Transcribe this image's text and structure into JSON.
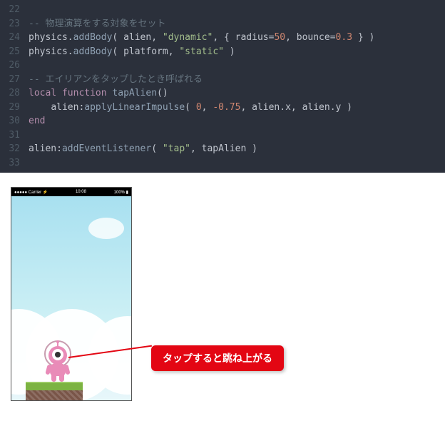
{
  "code": {
    "lines": [
      {
        "num": "22",
        "tokens": []
      },
      {
        "num": "23",
        "tokens": [
          {
            "t": "comment",
            "v": "-- 物理演算をする対象をセット"
          }
        ]
      },
      {
        "num": "24",
        "tokens": [
          {
            "t": "ident",
            "v": "physics"
          },
          {
            "t": "punct",
            "v": "."
          },
          {
            "t": "func",
            "v": "addBody"
          },
          {
            "t": "punct",
            "v": "( "
          },
          {
            "t": "ident",
            "v": "alien"
          },
          {
            "t": "punct",
            "v": ", "
          },
          {
            "t": "string",
            "v": "\"dynamic\""
          },
          {
            "t": "punct",
            "v": ", { "
          },
          {
            "t": "ident",
            "v": "radius"
          },
          {
            "t": "punct",
            "v": "="
          },
          {
            "t": "number",
            "v": "50"
          },
          {
            "t": "punct",
            "v": ", "
          },
          {
            "t": "ident",
            "v": "bounce"
          },
          {
            "t": "punct",
            "v": "="
          },
          {
            "t": "number",
            "v": "0.3"
          },
          {
            "t": "punct",
            "v": " } )"
          }
        ]
      },
      {
        "num": "25",
        "tokens": [
          {
            "t": "ident",
            "v": "physics"
          },
          {
            "t": "punct",
            "v": "."
          },
          {
            "t": "func",
            "v": "addBody"
          },
          {
            "t": "punct",
            "v": "( "
          },
          {
            "t": "ident",
            "v": "platform"
          },
          {
            "t": "punct",
            "v": ", "
          },
          {
            "t": "string",
            "v": "\"static\""
          },
          {
            "t": "punct",
            "v": " )"
          }
        ]
      },
      {
        "num": "26",
        "tokens": []
      },
      {
        "num": "27",
        "tokens": [
          {
            "t": "comment",
            "v": "-- エイリアンをタップしたとき呼ばれる"
          }
        ]
      },
      {
        "num": "28",
        "tokens": [
          {
            "t": "keyword",
            "v": "local"
          },
          {
            "t": "punct",
            "v": " "
          },
          {
            "t": "keyword",
            "v": "function"
          },
          {
            "t": "punct",
            "v": " "
          },
          {
            "t": "func",
            "v": "tapAlien"
          },
          {
            "t": "punct",
            "v": "()"
          }
        ]
      },
      {
        "num": "29",
        "tokens": [
          {
            "t": "punct",
            "v": "    "
          },
          {
            "t": "ident",
            "v": "alien"
          },
          {
            "t": "punct",
            "v": ":"
          },
          {
            "t": "func",
            "v": "applyLinearImpulse"
          },
          {
            "t": "punct",
            "v": "( "
          },
          {
            "t": "number",
            "v": "0"
          },
          {
            "t": "punct",
            "v": ", "
          },
          {
            "t": "orange",
            "v": "-"
          },
          {
            "t": "number",
            "v": "0.75"
          },
          {
            "t": "punct",
            "v": ", "
          },
          {
            "t": "ident",
            "v": "alien"
          },
          {
            "t": "punct",
            "v": "."
          },
          {
            "t": "ident",
            "v": "x"
          },
          {
            "t": "punct",
            "v": ", "
          },
          {
            "t": "ident",
            "v": "alien"
          },
          {
            "t": "punct",
            "v": "."
          },
          {
            "t": "ident",
            "v": "y"
          },
          {
            "t": "punct",
            "v": " )"
          }
        ]
      },
      {
        "num": "30",
        "tokens": [
          {
            "t": "keyword",
            "v": "end"
          }
        ]
      },
      {
        "num": "31",
        "tokens": []
      },
      {
        "num": "32",
        "tokens": [
          {
            "t": "ident",
            "v": "alien"
          },
          {
            "t": "punct",
            "v": ":"
          },
          {
            "t": "func",
            "v": "addEventListener"
          },
          {
            "t": "punct",
            "v": "( "
          },
          {
            "t": "string",
            "v": "\"tap\""
          },
          {
            "t": "punct",
            "v": ", "
          },
          {
            "t": "ident",
            "v": "tapAlien"
          },
          {
            "t": "punct",
            "v": " )"
          }
        ]
      },
      {
        "num": "33",
        "tokens": []
      }
    ]
  },
  "statusbar": {
    "carrier": "●●●●● Carrier ⚡",
    "time": "10:08",
    "battery": "100% ▮"
  },
  "callout": {
    "text": "タップすると跳ね上がる"
  }
}
